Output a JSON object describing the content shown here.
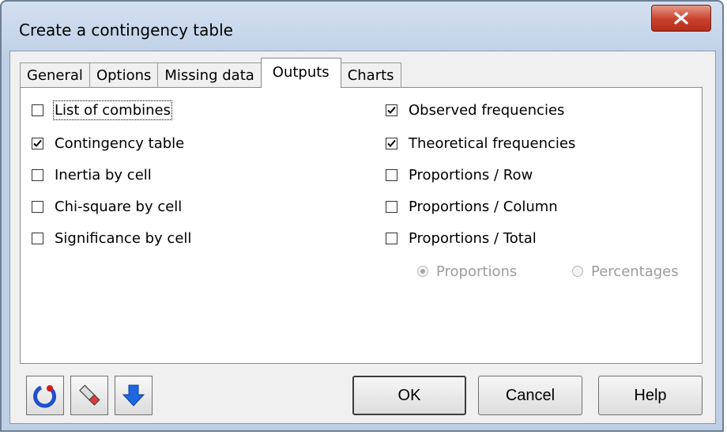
{
  "window": {
    "title": "Create a contingency table"
  },
  "tabs": [
    {
      "label": "General"
    },
    {
      "label": "Options"
    },
    {
      "label": "Missing data"
    },
    {
      "label": "Outputs",
      "active": true
    },
    {
      "label": "Charts"
    }
  ],
  "outputs": {
    "left": [
      {
        "label": "List of combines",
        "checked": false
      },
      {
        "label": "Contingency table",
        "checked": true
      },
      {
        "label": "Inertia by cell",
        "checked": false
      },
      {
        "label": "Chi-square by cell",
        "checked": false
      },
      {
        "label": "Significance by cell",
        "checked": false
      }
    ],
    "right": [
      {
        "label": "Observed frequencies",
        "checked": true
      },
      {
        "label": "Theoretical frequencies",
        "checked": true
      },
      {
        "label": "Proportions / Row",
        "checked": false
      },
      {
        "label": "Proportions / Column",
        "checked": false
      },
      {
        "label": "Proportions / Total",
        "checked": false
      }
    ],
    "radio": [
      {
        "label": "Proportions",
        "selected": true,
        "disabled": true
      },
      {
        "label": "Percentages",
        "selected": false,
        "disabled": true
      }
    ]
  },
  "buttons": {
    "ok": "OK",
    "cancel": "Cancel",
    "help": "Help"
  },
  "icons": {
    "reset": "reset-icon",
    "clear": "eraser-icon",
    "collapse": "arrow-down-icon"
  }
}
